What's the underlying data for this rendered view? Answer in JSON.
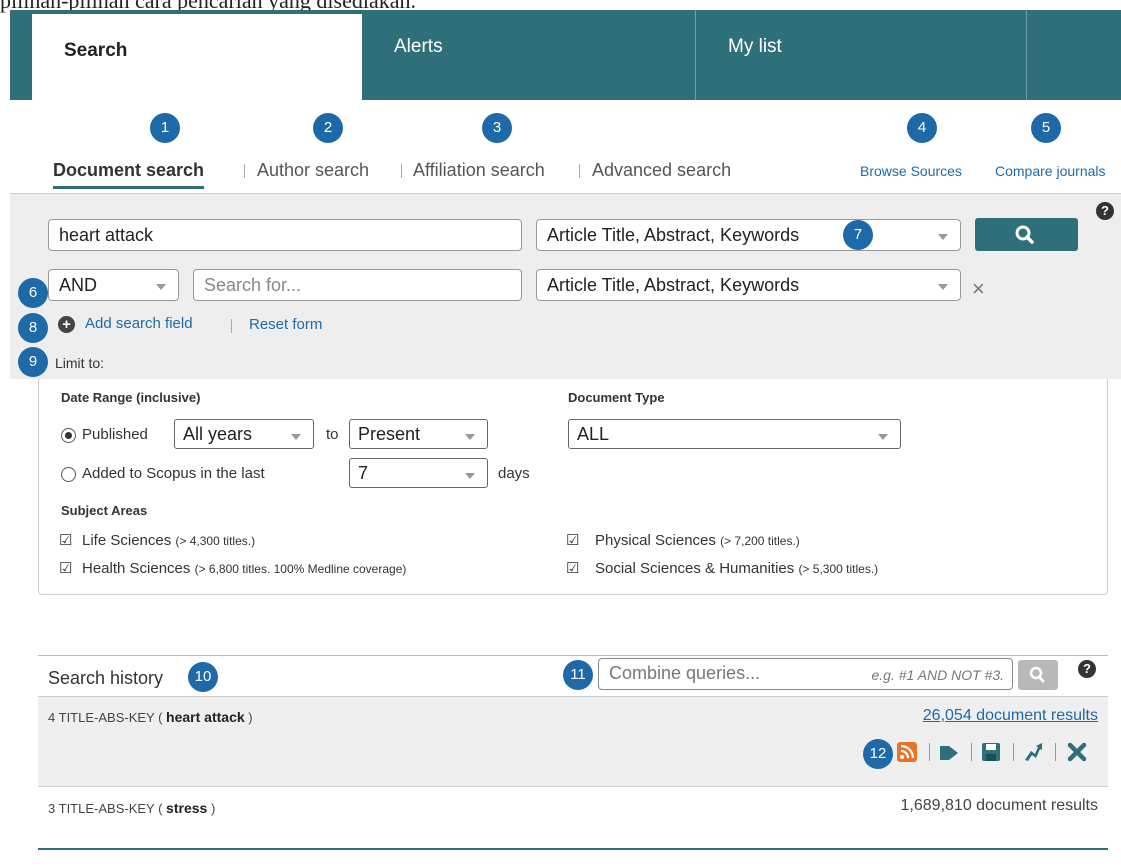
{
  "caption": "pilihan-pilihan cara pencarian yang disediakan.",
  "tabs": [
    "Search",
    "Alerts",
    "My list"
  ],
  "callouts": [
    "1",
    "2",
    "3",
    "4",
    "5",
    "6",
    "7",
    "8",
    "9",
    "10",
    "11",
    "12"
  ],
  "search_types": [
    "Document search",
    "Author search",
    "Affiliation search",
    "Advanced search"
  ],
  "right_links": {
    "browse": "Browse Sources",
    "compare": "Compare journals"
  },
  "form": {
    "query1": "heart attack",
    "field1": "Article Title, Abstract, Keywords",
    "operator": "AND",
    "query2_placeholder": "Search for...",
    "field2": "Article Title, Abstract, Keywords",
    "add_field": "Add search field",
    "reset": "Reset form",
    "limit_label": "Limit to:",
    "help_icon": "?"
  },
  "limits": {
    "date_range_label": "Date Range (inclusive)",
    "published_label": "Published",
    "published_selected": true,
    "from_value": "All years",
    "to_label": "to",
    "to_value": "Present",
    "added_label": "Added to Scopus in the last",
    "added_value": "7",
    "days_label": "days",
    "doc_type_label": "Document Type",
    "doc_type_value": "ALL",
    "subject_label": "Subject Areas",
    "subjects": [
      {
        "name": "Life Sciences",
        "note": "(> 4,300 titles.)",
        "checked": true
      },
      {
        "name": "Physical Sciences",
        "note": "(> 7,200 titles.)",
        "checked": true
      },
      {
        "name": "Health Sciences",
        "note": "(> 6,800 titles. 100% Medline coverage)",
        "checked": true
      },
      {
        "name": "Social Sciences & Humanities",
        "note": "(> 5,300 titles.)",
        "checked": true
      }
    ]
  },
  "history": {
    "title": "Search history",
    "combine_placeholder": "Combine queries...",
    "combine_example": "e.g. #1 AND NOT #3.",
    "rows": [
      {
        "num": "4",
        "prefix": "TITLE-ABS-KEY (",
        "term": "heart  attack",
        "suffix": ")",
        "results": "26,054 document results",
        "linked": true
      },
      {
        "num": "3",
        "prefix": "TITLE-ABS-KEY (",
        "term": "stress",
        "suffix": ")",
        "results": "1,689,810 document results",
        "linked": false
      }
    ]
  },
  "colors": {
    "accent": "#2e6f7a",
    "callout": "#1e6aa8",
    "link": "#1e6aa8",
    "rss": "#e8742a"
  },
  "icons": [
    "search-icon",
    "plus-circle-icon",
    "close-icon",
    "help-icon",
    "rss-icon",
    "tag-icon",
    "save-icon",
    "share-icon",
    "delete-icon",
    "radio-icon",
    "checkbox-icon"
  ]
}
